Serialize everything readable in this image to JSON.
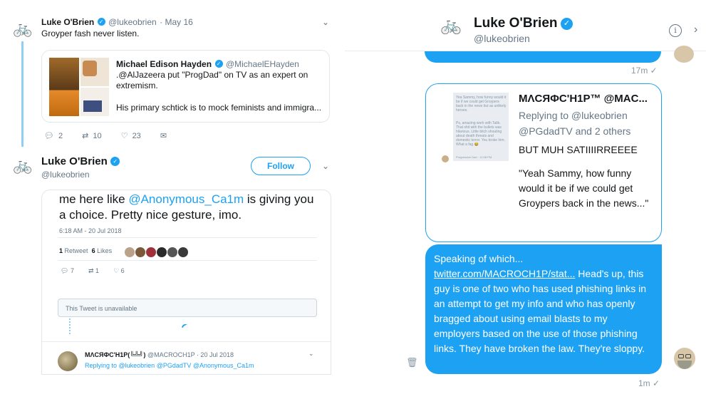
{
  "left_feed": {
    "tweet1": {
      "name": "Luke O'Brien",
      "handle": "@lukeobrien",
      "date": "· May 16",
      "text": "Groyper fash never listen.",
      "quote": {
        "name": "Michael Edison Hayden",
        "handle": "@MichaelEHayden",
        "text1": ".@AlJazeera put \"ProgDad\" on TV as an expert on extremism.",
        "text2": "His primary schtick is to mock feminists and immigra..."
      },
      "actions": {
        "replies": "2",
        "retweets": "10",
        "likes": "23"
      }
    },
    "tweet2": {
      "name": "Luke O'Brien",
      "handle": "@lukeobrien",
      "follow_label": "Follow",
      "embedded": {
        "text": "me here like @Anonymous_Ca1m is giving you a choice. Pretty nice gesture, imo.",
        "text_part1": "me here like ",
        "mention": "@Anonymous_Ca1m",
        "text_part2": " is giving you a choice. Pretty nice gesture, imo.",
        "timestamp": "6:18 AM - 20 Jul 2018",
        "retweets_count": "1",
        "retweets_label": "Retweet",
        "likes_count": "6",
        "likes_label": "Likes",
        "replies": "7",
        "rts": "1",
        "hearts": "6",
        "unavailable": "This Tweet is unavailable",
        "reply": {
          "name": "MΛCЯФC'H1P(╚╩╝)",
          "handle": "@MACROCH1P",
          "date": "· 20 Jul 2018",
          "replying": "Replying to @lukeobrien @PGdadTV @Anonymous_Ca1m"
        }
      }
    }
  },
  "dm": {
    "header": {
      "name": "Luke O'Brien",
      "handle": "@lukeobrien"
    },
    "ts1": "17m ✓",
    "card": {
      "name": "MΛCЯФC'H1P™ @MAC...",
      "replying": "Replying to @lukeobrien @PGdadTV and 2 others",
      "line1": "BUT MUH SATIIIIRREEEE",
      "line2": "\"Yeah Sammy, how funny would it be if we could get Groypers back in the news...\"",
      "img_lines": [
        "Yea Sammy, how funny would it be if we could get Groypers back in the news but as unlikely heroes.",
        "Ps, amazing work with Talib. That shit with the bullets was hilarious. Little bitch shouting about death threats and domestic terror. You broke him. What a fag 😂",
        "Progressive Dad · 12:08 PM"
      ]
    },
    "message": {
      "intro": "Speaking of which...",
      "link": "twitter.com/MACROCH1P/stat...",
      "body": " Head's up, this guy is one of two who has used phishing links in an attempt to get my info and who has openly bragged about using email blasts to my employers based on the use of those phishing links. They have broken the law. They're sloppy."
    },
    "ts2": "1m ✓"
  },
  "colors": {
    "accent": "#1da1f2",
    "text": "#14171a",
    "muted": "#657786"
  },
  "icons": [
    "bicycle-avatar-icon",
    "verified-icon",
    "chevron-down-icon",
    "info-icon",
    "chevron-right-icon",
    "trash-icon",
    "reply-icon",
    "retweet-icon",
    "heart-icon",
    "mail-icon"
  ]
}
